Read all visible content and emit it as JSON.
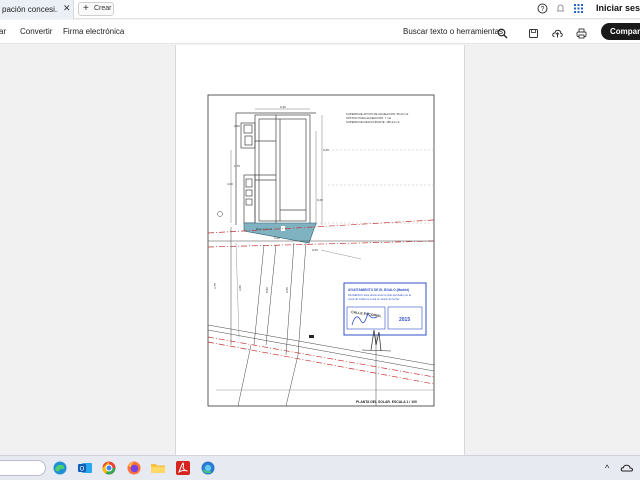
{
  "browser": {
    "tab_title": "pación concesi...",
    "tab_close": "✕",
    "new_tab_label": "Crear",
    "signin_label": "Iniciar sesi"
  },
  "toolbar": {
    "menu_items": [
      "ar",
      "Convertir",
      "Firma electrónica"
    ],
    "search_label": "Buscar texto o herramientas",
    "share_label": "Compart"
  },
  "document": {
    "header_notes": [
      "SUPERFICIE APTOS DE ALINEACION: 55,23 m2",
      "SÓTANO PARA ALINEACIÓN: 7 m2",
      "SUPERFICIE DESOCUPANTE: 185,24 m2"
    ],
    "area_label": "Bajo = 7 m2",
    "street_label": "CALLE ESCORIAL",
    "plan_title": "PLANTA DEL SOLAR.  ESCALA 1 / 100",
    "stamp": {
      "line1": "AYUNTAMIENTO DE EL BOALO (Madrid)",
      "line2": "DILIGENCIA: Este documento ha sido aprobado por la",
      "line3": "Junta de Gobierno Local en sesión de fecha:",
      "year": "2015"
    },
    "dimensions": {
      "top_width": "6,20",
      "left_small": "2,00",
      "left_small2": "1,75",
      "right_vertical": "9,25",
      "right_vertical2": "9,25",
      "left_vertical": "4,00",
      "lower_left": "3,80",
      "mid_a": "8,80",
      "mid_b": "9,65",
      "bottom_dim": "3,40",
      "bottom_dim2": "0,60",
      "far_left": "3,75"
    }
  },
  "taskbar": {
    "apps": [
      "edge-icon",
      "outlook-icon",
      "chrome-icon",
      "firefox-icon",
      "file-explorer-icon",
      "acrobat-icon",
      "edge-alt-icon"
    ]
  },
  "colors": {
    "highlight_fill": "#7fb3c1",
    "stamp_blue": "#3050c8",
    "boundary_red": "#c83232"
  }
}
